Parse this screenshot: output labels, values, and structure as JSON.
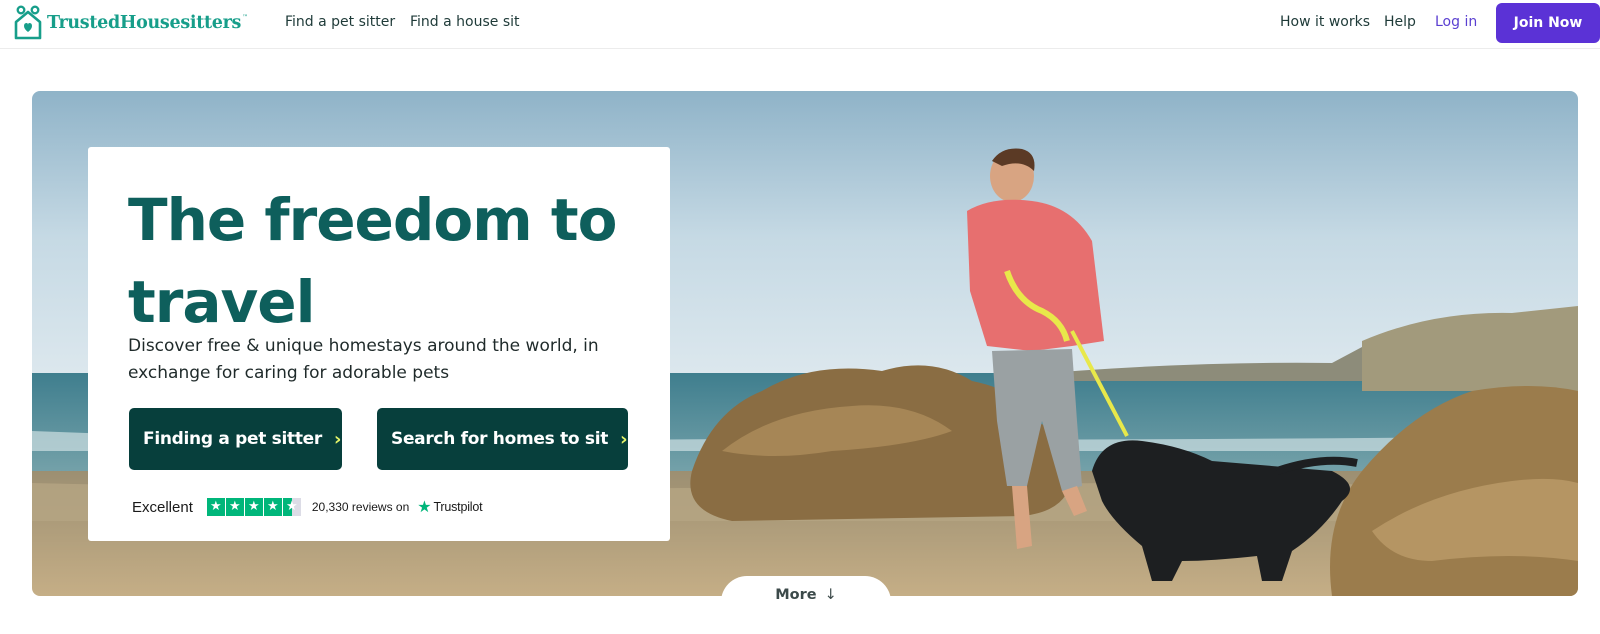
{
  "header": {
    "logo_text": "TrustedHousesitters",
    "logo_tm": "™",
    "nav_left": [
      "Find a pet sitter",
      "Find a house sit"
    ],
    "nav_right": [
      "How it works",
      "Help"
    ],
    "login_label": "Log in",
    "join_label": "Join Now"
  },
  "hero": {
    "headline": "The freedom to travel",
    "subtext": "Discover free & unique homestays around the world, in exchange for caring for adorable pets",
    "cta_primary": "Finding a pet sitter",
    "cta_secondary": "Search for homes to sit",
    "chevron": "›"
  },
  "trustpilot": {
    "rating_word": "Excellent",
    "stars_rating": 4.5,
    "reviews_text": "20,330 reviews on",
    "brand": "Trustpilot",
    "star_glyph": "★"
  },
  "more": {
    "label": "More",
    "arrow": "↓"
  },
  "colors": {
    "brand_teal": "#179e8a",
    "headline_teal": "#0e5f5c",
    "cta_dark": "#073f3c",
    "join_purple": "#5b32d6",
    "login_purple": "#5a3fd1",
    "trustpilot_green": "#00b67a",
    "chevron_yellow": "#e6f56a"
  },
  "icons": {
    "logo": "house-paw-logo-icon",
    "cta_chevron": "chevron-right-icon",
    "more_arrow": "arrow-down-icon",
    "trustpilot_star": "star-icon"
  }
}
